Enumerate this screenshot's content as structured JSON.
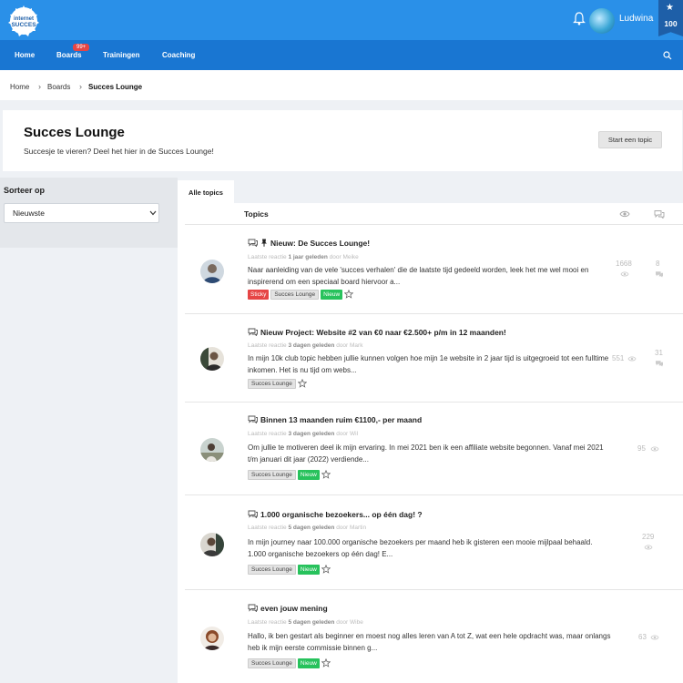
{
  "brand": {
    "logo_alt": "internet-succes-logo"
  },
  "user": {
    "name": "Ludwina",
    "score": "100"
  },
  "nav": {
    "items": [
      "Home",
      "Boards",
      "Trainingen",
      "Coaching"
    ],
    "boards_badge": "99+"
  },
  "breadcrumb": [
    "Home",
    "Boards",
    "Succes Lounge"
  ],
  "header": {
    "title": "Succes Lounge",
    "subtitle": "Succesje te vieren? Deel het hier in de Succes Lounge!",
    "start_button": "Start een topic"
  },
  "sidebar": {
    "sort_label": "Sorteer op",
    "sort_value": "Nieuwste"
  },
  "tabs": {
    "active": "Alle topics"
  },
  "table": {
    "col_topics": "Topics"
  },
  "topics": [
    {
      "title": "Nieuw: De Succes Lounge!",
      "meta_prefix": "Laatste reactie",
      "meta_time": "1 jaar geleden",
      "meta_by": "door Meike",
      "excerpt": "Naar aanleiding van de vele 'succes verhalen' die de laatste tijd gedeeld worden, leek het me wel mooi en inspirerend om een speciaal board hiervoor a...",
      "tags": [
        "Sticky",
        "Succes Lounge",
        "Nieuw"
      ],
      "views": "1668",
      "replies": "8"
    },
    {
      "title": "Nieuw Project: Website #2 van €0 naar €2.500+ p/m in 12 maanden!",
      "meta_prefix": "Laatste reactie",
      "meta_time": "3 dagen geleden",
      "meta_by": "door Mark",
      "excerpt": "In mijn 10k club topic hebben jullie kunnen volgen hoe mijn 1e website in 2 jaar tijd is uitgegroeid tot een fulltime inkomen. Het is nu tijd om webs...",
      "tags": [
        "Succes Lounge"
      ],
      "views": "551",
      "replies": "31"
    },
    {
      "title": "Binnen 13 maanden ruim €1100,- per maand",
      "meta_prefix": "Laatste reactie",
      "meta_time": "3 dagen geleden",
      "meta_by": "door Wil",
      "excerpt": "Om jullie te motiveren deel ik mijn ervaring. In mei 2021 ben ik een affiliate website begonnen. Vanaf mei 2021 t/m januari dit jaar (2022) verdiende...",
      "tags": [
        "Succes Lounge",
        "Nieuw"
      ],
      "views": "95",
      "replies": ""
    },
    {
      "title": "1.000 organische bezoekers... op één dag! ?",
      "meta_prefix": "Laatste reactie",
      "meta_time": "5 dagen geleden",
      "meta_by": "door Martin",
      "excerpt": "In mijn journey naar 100.000 organische bezoekers per maand heb ik gisteren een mooie mijlpaal behaald. 1.000 organische bezoekers op één dag! E...",
      "tags": [
        "Succes Lounge",
        "Nieuw"
      ],
      "views": "229",
      "replies": ""
    },
    {
      "title": "even jouw mening",
      "meta_prefix": "Laatste reactie",
      "meta_time": "5 dagen geleden",
      "meta_by": "door Wibe",
      "excerpt": "Hallo, ik ben gestart als beginner en moest nog alles leren van A tot Z, wat een hele opdracht was, maar onlangs heb ik mijn eerste commissie binnen g...",
      "tags": [
        "Succes Lounge",
        "Nieuw"
      ],
      "views": "63",
      "replies": ""
    }
  ],
  "colors": {
    "topbar": "#2a90e8",
    "navbar": "#1976d2",
    "sticky": "#e64545",
    "new": "#27c25c"
  }
}
